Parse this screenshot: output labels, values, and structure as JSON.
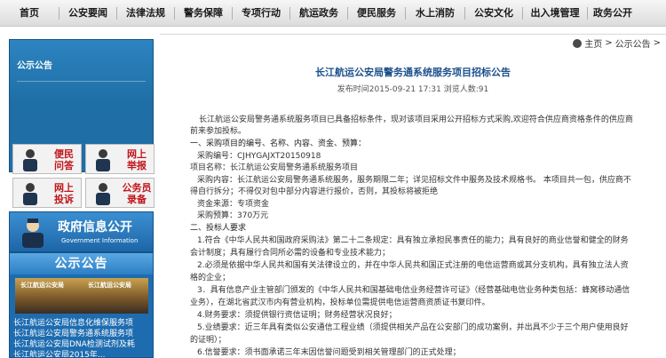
{
  "nav": {
    "items": [
      "首页",
      "公安要闻",
      "法律法规",
      "警务保障",
      "专项行动",
      "航运政务",
      "便民服务",
      "水上消防",
      "公安文化",
      "出入境管理",
      "政务公开"
    ]
  },
  "sidebar": {
    "notice_box_title": "公示公告",
    "services": [
      {
        "label1": "便民",
        "label2": "问答"
      },
      {
        "label1": "网上",
        "label2": "举报"
      },
      {
        "label1": "网上",
        "label2": "投诉"
      },
      {
        "label1": "公务员",
        "label2": "录备"
      }
    ],
    "gov_info": {
      "title": "政府信息公开",
      "subtitle": "Government Information"
    },
    "notice_panel": {
      "title": "公示公告",
      "photo_left": "长江航运公安局",
      "photo_right": "长江航运公安局",
      "links": [
        "长江航运公安局信息化维保服务项",
        "长江航运公安局警务通系统服务项",
        "长江航运公安局DNA检测试剂及耗",
        "长江航运公安局2015年..."
      ]
    }
  },
  "breadcrumb": {
    "home": "主页",
    "sep": ">",
    "section": "公示公告",
    "tail": ">"
  },
  "article": {
    "title": "长江航运公安局警务通系统服务项目招标公告",
    "meta": "发布时间2015-09-21 17:31 浏览人数:91",
    "lines": [
      "长江航运公安局警务通系统服务项目已具备招标条件，现对该项目采用公开招标方式采购,欢迎符合供应商资格条件的供应商",
      "前来参加投标。",
      "一、采购项目的编号、名称、内容、资金、预算：",
      "采购编号：CJHYGAJXT20150918",
      "项目名称：长江航运公安局警务通系统服务项目",
      "采购内容：长江航运公安局警务通系统服务，服务期限二年；详见招标文件中服务及技术规格书。 本项目共一包，供应商不",
      "得自行拆分；不得仅对包中部分内容进行报价，否则，其投标将被拒绝",
      "资金来源：专项资金",
      "采购预算：370万元",
      "二、投标人要求",
      "1.符合《中华人民共和国政府采购法》第二十二条规定：具有独立承担民事责任的能力；具有良好的商业信誉和健全的财务",
      "会计制度；具有履行合同所必需的设备和专业技术能力；",
      "2.必须是依据中华人民共和国有关法律设立的，并在中华人民共和国正式注册的电信运营商或其分支机构，具有独立法人资",
      "格的企业；",
      "3．具有信息产业主管部门颁发的《中华人民共和国基础电信业务经营许可证》（经营基础电信业务种类包括：蜂窝移动通信",
      "业务），在湖北省武汉市内有营业机构，投标单位需提供电信运营商资质证书复印件。",
      "4.财务要求：须提供银行资信证明；财务经营状况良好；",
      "5.业绩要求：近三年具有类似公安通信工程业绩（须提供相关产品在公安部门的成功案例，并出具不少于三个用户使用良好",
      "的证明）；",
      "6.信誉要求：须书面承诺三年末因信誉问题受到相关管理部门的正式处理；"
    ]
  },
  "colors": {
    "title_blue": "#1b4f8a",
    "sidebar_blue": "#1e6cb0",
    "service_red": "#c0151b",
    "nav_bg": "#e6e6e6"
  }
}
